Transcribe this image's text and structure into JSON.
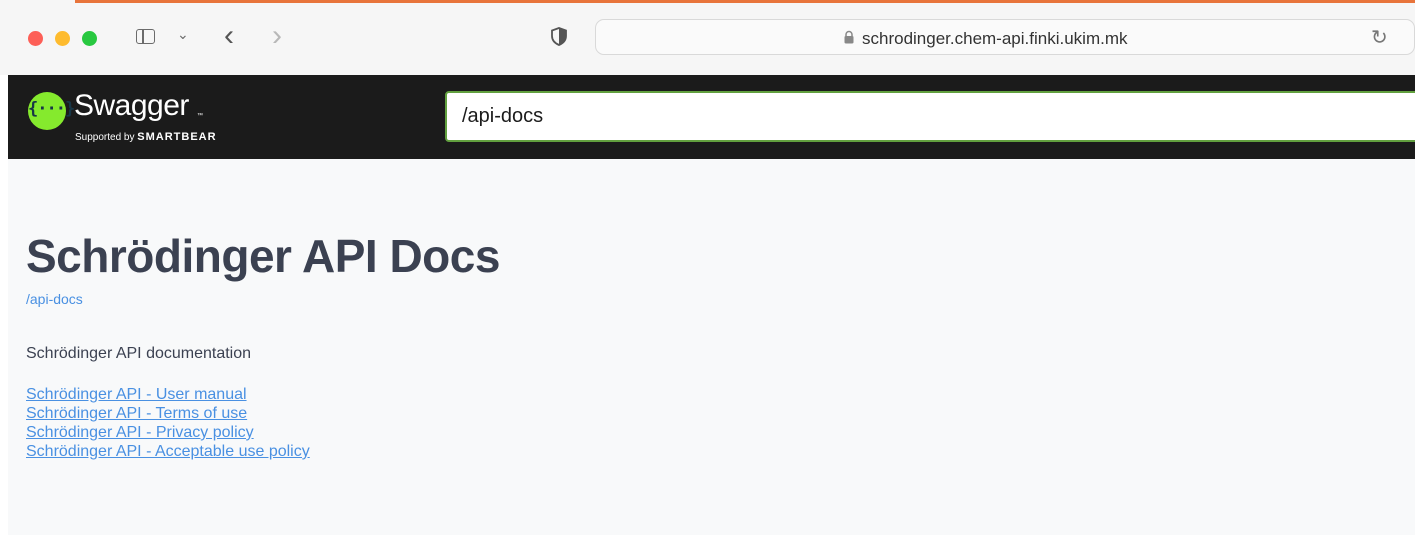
{
  "browser": {
    "url": "schrodinger.chem-api.finki.ukim.mk",
    "accent_color": "#e8743b"
  },
  "topbar": {
    "logo_symbol": "{···}",
    "logo_word": "Swagger",
    "logo_tm": "™",
    "logo_supported_by": "Supported by",
    "logo_smartbear": "SMARTBEAR",
    "url_input_value": "/api-docs",
    "brand_green": "#85ea2d",
    "background": "#1b1b1b"
  },
  "info": {
    "title": "Schrödinger API Docs",
    "base_url": "/api-docs",
    "description": "Schrödinger API documentation",
    "links": [
      "Schrödinger API - User manual",
      "Schrödinger API - Terms of use",
      "Schrödinger API - Privacy policy",
      "Schrödinger API - Acceptable use policy"
    ],
    "link_color": "#4990e2",
    "title_color": "#3b4151"
  },
  "icons": [
    "sidebar-icon",
    "chevron-down-icon",
    "back-arrow-icon",
    "forward-arrow-icon",
    "shield-icon",
    "lock-icon",
    "reload-icon",
    "swagger-logo-icon"
  ]
}
